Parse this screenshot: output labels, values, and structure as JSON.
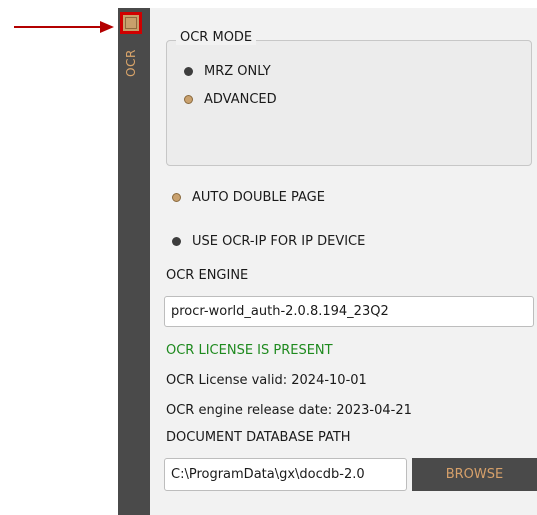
{
  "sidebar": {
    "tab_label": "OCR"
  },
  "ocr_mode": {
    "legend": "OCR MODE",
    "options": [
      {
        "label": "MRZ ONLY",
        "state": "dark"
      },
      {
        "label": "ADVANCED",
        "state": "orange"
      }
    ]
  },
  "options": {
    "auto_double_page": "AUTO DOUBLE PAGE",
    "use_ocr_ip": "USE OCR-IP FOR IP DEVICE"
  },
  "engine": {
    "label": "OCR ENGINE",
    "value": "procr-world_auth-2.0.8.194_23Q2"
  },
  "license": {
    "status": "OCR LICENSE IS PRESENT",
    "valid": "OCR License valid: 2024-10-01",
    "release": "OCR engine release date: 2023-04-21",
    "status_color": "#1e8a1e"
  },
  "docdb": {
    "label": "DOCUMENT DATABASE PATH",
    "value": "C:\\ProgramData\\gx\\docdb-2.0",
    "browse_label": "BROWSE"
  },
  "colors": {
    "accent": "#c8a06b",
    "annotation_red": "#b30000",
    "sidebar_bg": "#4a4a4a"
  }
}
